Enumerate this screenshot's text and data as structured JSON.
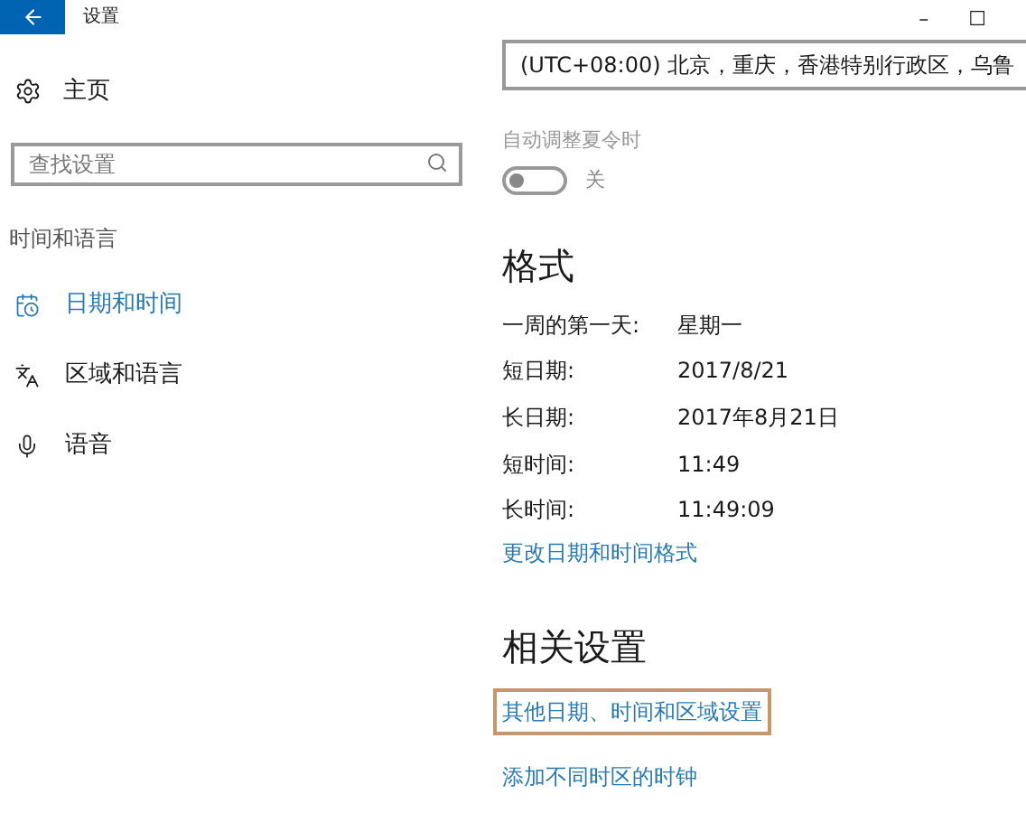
{
  "window": {
    "title": "设置",
    "controls": [
      "–",
      "☐"
    ]
  },
  "sidebar": {
    "home": "主页",
    "search": {
      "placeholder": "查找设置"
    },
    "section": "时间和语言",
    "items": [
      {
        "label": "日期和时间",
        "kind": "calendar",
        "selected": true
      },
      {
        "label": "区域和语言",
        "kind": "language",
        "selected": false
      },
      {
        "label": "语音",
        "kind": "microphone",
        "selected": false
      }
    ]
  },
  "timezone": {
    "value": "(UTC+08:00) 北京，重庆，香港特别行政区，乌鲁"
  },
  "dst": {
    "label": "自动调整夏令时",
    "on": false,
    "state_text": "关"
  },
  "formats": {
    "title": "格式",
    "rows": [
      {
        "label": "一周的第一天:",
        "value": "星期一"
      },
      {
        "label": "短日期:",
        "value": "2017/8/21"
      },
      {
        "label": "长日期:",
        "value": "2017年8月21日"
      },
      {
        "label": "短时间:",
        "value": "11:49"
      },
      {
        "label": "长时间:",
        "value": "11:49:09"
      }
    ],
    "link": "更改日期和时间格式"
  },
  "related": {
    "title": "相关设置",
    "links": [
      {
        "label": "其他日期、时间和区域设置",
        "highlighted": true
      },
      {
        "label": "添加不同时区的时钟",
        "highlighted": false
      }
    ]
  }
}
